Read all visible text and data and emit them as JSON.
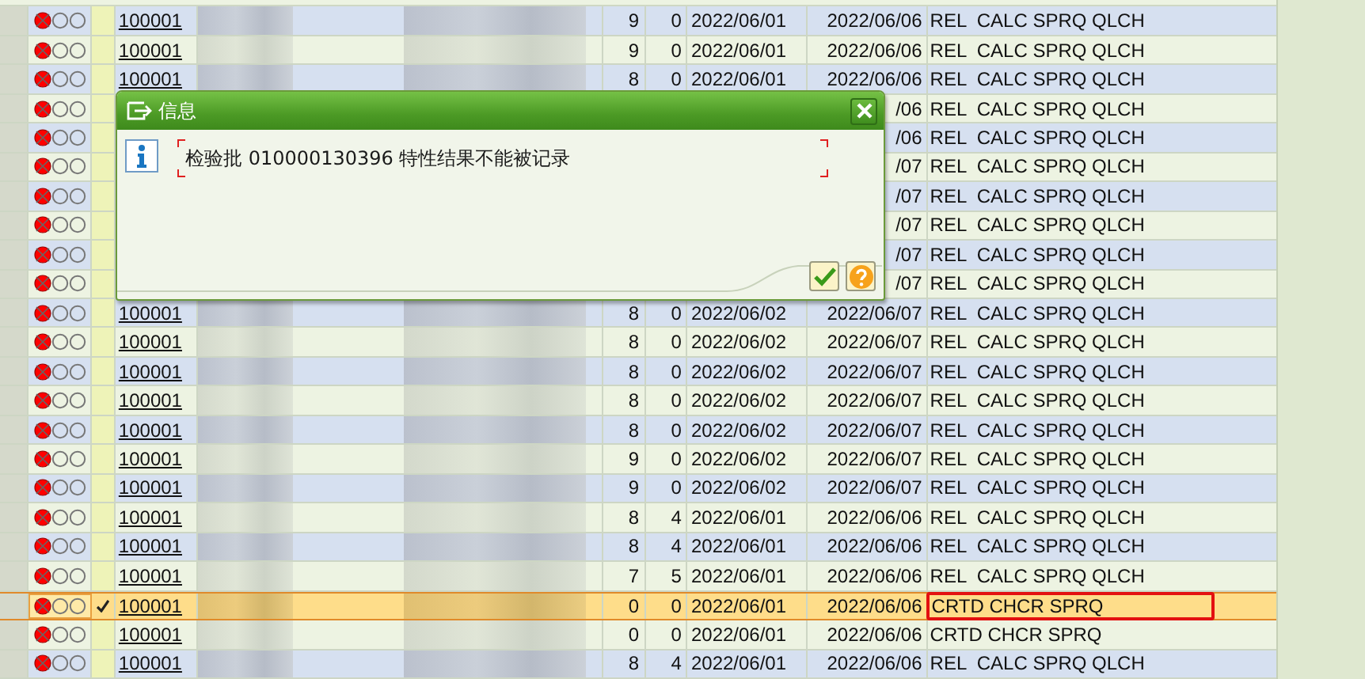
{
  "table": {
    "rows": [
      {
        "link": "100001",
        "column_4": "9",
        "column_5": "0",
        "column_6": "2022/06/01",
        "column_7": "2022/06/06",
        "column_8": "REL  CALC SPRQ QLCH",
        "selected": false,
        "flagged": false
      },
      {
        "link": "100001",
        "column_4": "9",
        "column_5": "0",
        "column_6": "2022/06/01",
        "column_7": "2022/06/06",
        "column_8": "REL  CALC SPRQ QLCH",
        "selected": false,
        "flagged": false
      },
      {
        "link": "100001",
        "column_4": "8",
        "column_5": "0",
        "column_6": "2022/06/01",
        "column_7": "2022/06/06",
        "column_8": "REL  CALC SPRQ QLCH",
        "selected": false,
        "flagged": false
      },
      {
        "column_7": "/06",
        "column_8": "REL  CALC SPRQ QLCH",
        "selected": false,
        "flagged": false
      },
      {
        "column_7": "/06",
        "column_8": "REL  CALC SPRQ QLCH",
        "selected": false,
        "flagged": false
      },
      {
        "column_7": "/07",
        "column_8": "REL  CALC SPRQ QLCH",
        "selected": false,
        "flagged": false
      },
      {
        "column_7": "/07",
        "column_8": "REL  CALC SPRQ QLCH",
        "selected": false,
        "flagged": false
      },
      {
        "column_7": "/07",
        "column_8": "REL  CALC SPRQ QLCH",
        "selected": false,
        "flagged": false
      },
      {
        "column_7": "/07",
        "column_8": "REL  CALC SPRQ QLCH",
        "selected": false,
        "flagged": false
      },
      {
        "column_7": "/07",
        "column_8": "REL  CALC SPRQ QLCH",
        "selected": false,
        "flagged": false
      },
      {
        "link": "100001",
        "column_4": "8",
        "column_5": "0",
        "column_6": "2022/06/02",
        "column_7": "2022/06/07",
        "column_8": "REL  CALC SPRQ QLCH",
        "selected": false,
        "flagged": false
      },
      {
        "link": "100001",
        "column_4": "8",
        "column_5": "0",
        "column_6": "2022/06/02",
        "column_7": "2022/06/07",
        "column_8": "REL  CALC SPRQ QLCH",
        "selected": false,
        "flagged": false
      },
      {
        "link": "100001",
        "column_4": "8",
        "column_5": "0",
        "column_6": "2022/06/02",
        "column_7": "2022/06/07",
        "column_8": "REL  CALC SPRQ QLCH",
        "selected": false,
        "flagged": false
      },
      {
        "link": "100001",
        "column_4": "8",
        "column_5": "0",
        "column_6": "2022/06/02",
        "column_7": "2022/06/07",
        "column_8": "REL  CALC SPRQ QLCH",
        "selected": false,
        "flagged": false
      },
      {
        "link": "100001",
        "column_4": "8",
        "column_5": "0",
        "column_6": "2022/06/02",
        "column_7": "2022/06/07",
        "column_8": "REL  CALC SPRQ QLCH",
        "selected": false,
        "flagged": false
      },
      {
        "link": "100001",
        "column_4": "9",
        "column_5": "0",
        "column_6": "2022/06/02",
        "column_7": "2022/06/07",
        "column_8": "REL  CALC SPRQ QLCH",
        "selected": false,
        "flagged": false
      },
      {
        "link": "100001",
        "column_4": "9",
        "column_5": "0",
        "column_6": "2022/06/02",
        "column_7": "2022/06/07",
        "column_8": "REL  CALC SPRQ QLCH",
        "selected": false,
        "flagged": false
      },
      {
        "link": "100001",
        "column_4": "8",
        "column_5": "4",
        "column_6": "2022/06/01",
        "column_7": "2022/06/06",
        "column_8": "REL  CALC SPRQ QLCH",
        "selected": false,
        "flagged": false
      },
      {
        "link": "100001",
        "column_4": "8",
        "column_5": "4",
        "column_6": "2022/06/01",
        "column_7": "2022/06/06",
        "column_8": "REL  CALC SPRQ QLCH",
        "selected": false,
        "flagged": false
      },
      {
        "link": "100001",
        "column_4": "7",
        "column_5": "5",
        "column_6": "2022/06/01",
        "column_7": "2022/06/06",
        "column_8": "REL  CALC SPRQ QLCH",
        "selected": false,
        "flagged": false
      },
      {
        "link": "100001",
        "column_4": "0",
        "column_5": "0",
        "column_6": "2022/06/01",
        "column_7": "2022/06/06",
        "column_8": "CRTD CHCR SPRQ",
        "selected": true,
        "flagged": true
      },
      {
        "link": "100001",
        "column_4": "0",
        "column_5": "0",
        "column_6": "2022/06/01",
        "column_7": "2022/06/06",
        "column_8": "CRTD CHCR SPRQ",
        "selected": false,
        "flagged": false
      },
      {
        "link": "100001",
        "column_4": "8",
        "column_5": "4",
        "column_6": "2022/06/01",
        "column_7": "2022/06/06",
        "column_8": "REL  CALC SPRQ QLCH",
        "selected": false,
        "flagged": false
      }
    ]
  },
  "dialog": {
    "title": "信息",
    "message": "检验批 010000130396 特性结果不能被记录"
  }
}
